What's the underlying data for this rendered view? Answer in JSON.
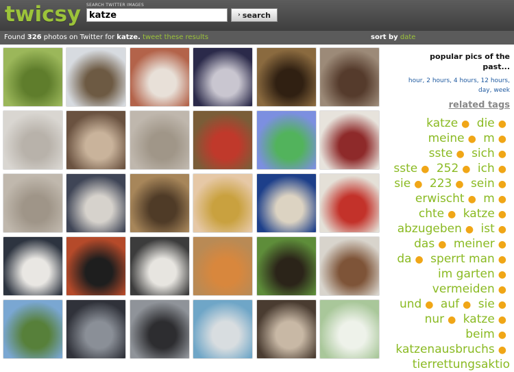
{
  "header": {
    "logo": "twicsy",
    "search_label": "SEARCH TWITTER IMAGES",
    "search_value": "katze",
    "search_button_label": "search",
    "search_button_icon": "arrow-right-icon"
  },
  "infobar": {
    "found_prefix": "Found",
    "found_count": "326",
    "found_middle": "photos on Twitter for",
    "found_query": "katze.",
    "tweet_link": "tweet these results",
    "sort_label": "sort by",
    "sort_link": "date"
  },
  "sidebar": {
    "popular_title": "popular pics of the past...",
    "time_links": [
      "hour",
      "2 hours",
      "4 hours",
      "12 hours",
      "day",
      "week"
    ],
    "related_title": "related tags",
    "tags": [
      "katze",
      "die",
      "meine",
      "m",
      "sste",
      "sich",
      "sste",
      "252",
      "ich",
      "sie",
      "223",
      "sein",
      "erwischt",
      "m",
      "chte",
      "katze",
      "abzugeben",
      "ist",
      "das",
      "meiner",
      "da",
      "sperrt man",
      "im garten",
      "vermeiden",
      "und",
      "auf",
      "sie",
      "nur",
      "katze",
      "beim",
      "katzenausbruchs",
      "tierrettungsaktio"
    ]
  },
  "colors": {
    "brand_green": "#9cc33a",
    "tag_green": "#8aba22",
    "dot_orange": "#f0a617",
    "link_blue": "#1f5aa0",
    "header_dark": "#4a4a4a"
  },
  "photos": [
    {
      "alt": "cat on grass",
      "c1": "#9bb75a",
      "c2": "#5f7d2c"
    },
    {
      "alt": "cat in tree",
      "c1": "#d7dbe0",
      "c2": "#6d5a43"
    },
    {
      "alt": "cat on rug",
      "c1": "#b3634a",
      "c2": "#e8e0d8"
    },
    {
      "alt": "black cat on blanket",
      "c1": "#2b2a4a",
      "c2": "#c9c6d0"
    },
    {
      "alt": "cat under furniture",
      "c1": "#8a6a3f",
      "c2": "#302012"
    },
    {
      "alt": "tabby cat with pen",
      "c1": "#9c8a78",
      "c2": "#553b2c"
    },
    {
      "alt": "cat fur close-up",
      "c1": "#d9d6d1",
      "c2": "#b8b2aa"
    },
    {
      "alt": "blurry cat",
      "c1": "#6a5240",
      "c2": "#c9b39b"
    },
    {
      "alt": "carpet floor",
      "c1": "#bfb7ad",
      "c2": "#a09688"
    },
    {
      "alt": "cat with book",
      "c1": "#7a5d38",
      "c2": "#c0392b"
    },
    {
      "alt": "colorful painted cat",
      "c1": "#7c8fe0",
      "c2": "#52b35c"
    },
    {
      "alt": "window of house",
      "c1": "#e7e3dc",
      "c2": "#8e2a2a"
    },
    {
      "alt": "carpet floor",
      "c1": "#c0b8ad",
      "c2": "#9f9588"
    },
    {
      "alt": "cat on sofa",
      "c1": "#3f4556",
      "c2": "#d6d2cc"
    },
    {
      "alt": "cats in basket",
      "c1": "#a7865a",
      "c2": "#4f3b27"
    },
    {
      "alt": "boy with glasses",
      "c1": "#e6c8a6",
      "c2": "#c9a13f"
    },
    {
      "alt": "gib mir fünf cat card",
      "c1": "#1d3f8a",
      "c2": "#dcd3c2"
    },
    {
      "alt": "cat toy",
      "c1": "#e4e0d7",
      "c2": "#c3322a"
    },
    {
      "alt": "black white cat",
      "c1": "#2d3440",
      "c2": "#e9e7e3"
    },
    {
      "alt": "black cat at window",
      "c1": "#b54a2a",
      "c2": "#1e1e1e"
    },
    {
      "alt": "cat on carpet",
      "c1": "#3c3c3c",
      "c2": "#e7e5e0"
    },
    {
      "alt": "orange cat",
      "c1": "#b98a55",
      "c2": "#d8873d"
    },
    {
      "alt": "dog in grass",
      "c1": "#5e8d3a",
      "c2": "#2b2419"
    },
    {
      "alt": "cat on radiator",
      "c1": "#d8d4cc",
      "c2": "#7e5438"
    },
    {
      "alt": "house and trees",
      "c1": "#7aa7d2",
      "c2": "#57803a"
    },
    {
      "alt": "dark cat",
      "c1": "#30323a",
      "c2": "#8a8f97"
    },
    {
      "alt": "cat in box",
      "c1": "#8f9399",
      "c2": "#2d2d30"
    },
    {
      "alt": "cat with sign",
      "c1": "#6fa6c7",
      "c2": "#d8dde0"
    },
    {
      "alt": "cat on floor",
      "c1": "#4a3c31",
      "c2": "#c8b8a5"
    },
    {
      "alt": "green pixel image",
      "c1": "#a9c79a",
      "c2": "#eef2ea"
    }
  ]
}
